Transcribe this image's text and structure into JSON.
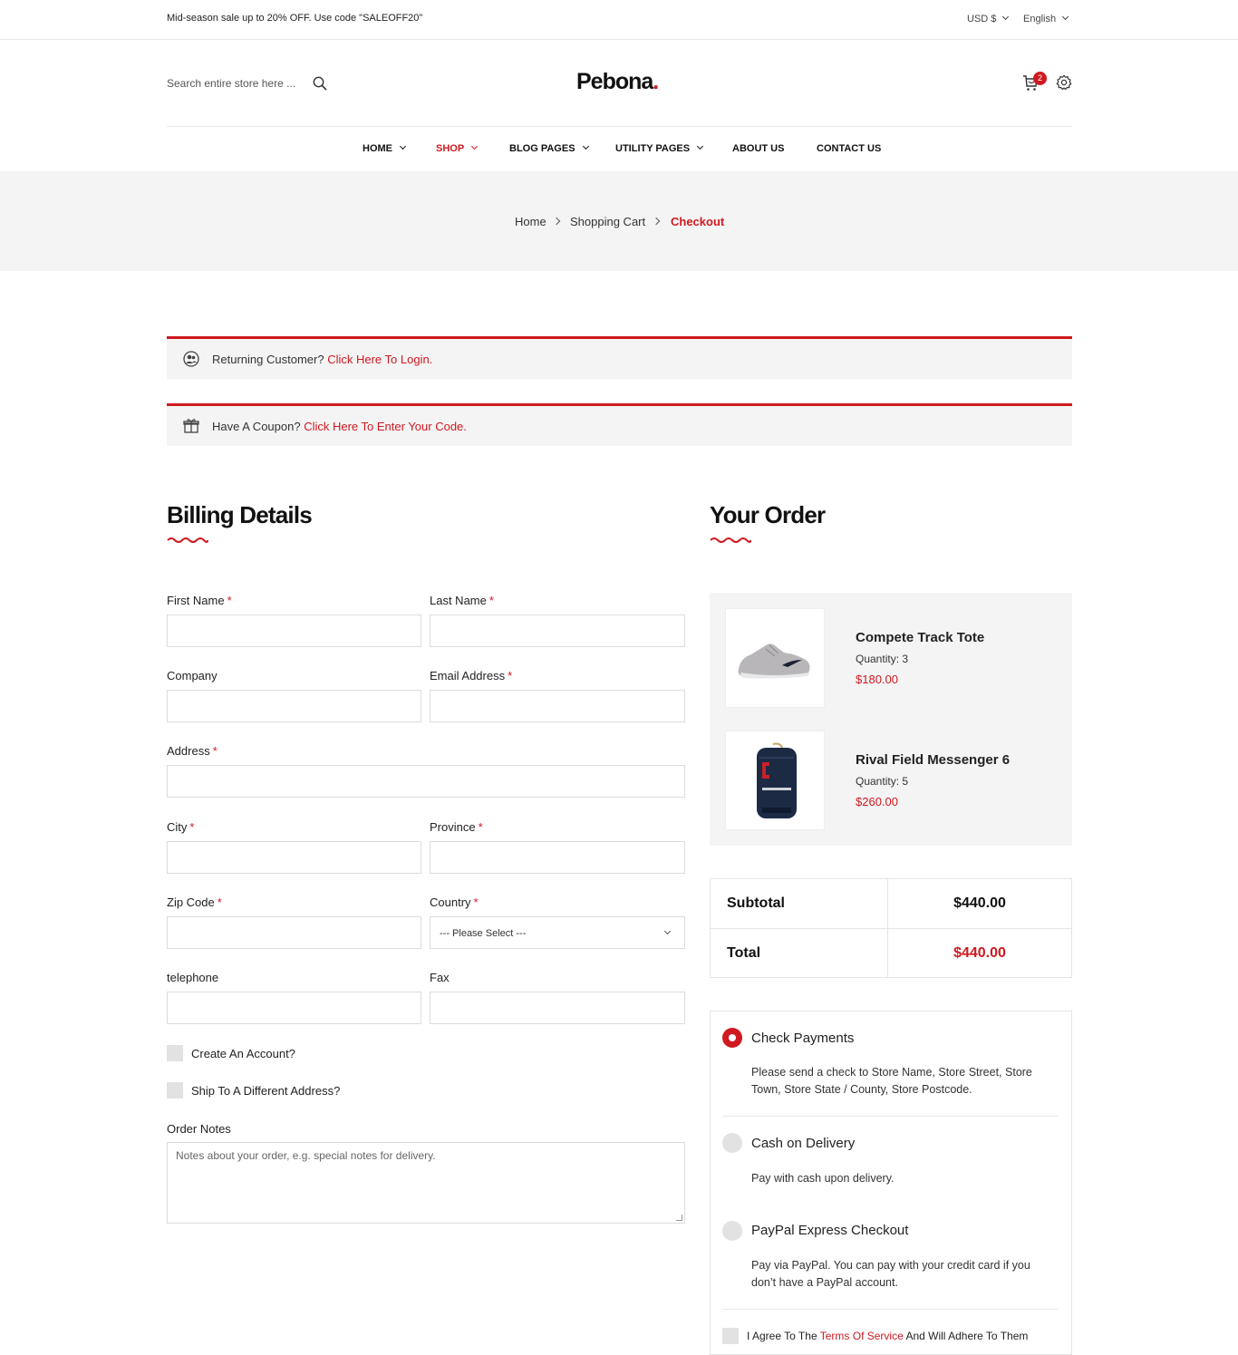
{
  "topbar": {
    "promo": "Mid-season sale up to 20% OFF. Use code \"SALEOFF20\"",
    "currency": "USD $",
    "language": "English"
  },
  "header": {
    "search_placeholder": "Search entire store here ...",
    "logo": "Pebona",
    "logo_dot": ".",
    "cart_count": "2"
  },
  "nav": {
    "home": "HOME",
    "shop": "SHOP",
    "blog": "BLOG PAGES",
    "utility": "UTILITY PAGES",
    "about": "ABOUT US",
    "contact": "CONTACT US"
  },
  "breadcrumb": {
    "home": "Home",
    "cart": "Shopping Cart",
    "current": "Checkout"
  },
  "notices": {
    "login_text": "Returning Customer?",
    "login_link": "Click Here To Login.",
    "coupon_text": "Have A Coupon?",
    "coupon_link": "Click Here To Enter Your Code."
  },
  "billing": {
    "title": "Billing Details",
    "first_name": "First Name",
    "last_name": "Last Name",
    "company": "Company",
    "email": "Email Address",
    "address": "Address",
    "city": "City",
    "province": "Province",
    "zip": "Zip Code",
    "country": "Country",
    "country_value": "--- Please Select ---",
    "telephone": "telephone",
    "fax": "Fax",
    "create_account": "Create An Account?",
    "ship_different": "Ship To A Different Address?",
    "order_notes": "Order Notes",
    "notes_placeholder": "Notes about your order, e.g. special notes for delivery.",
    "required_mark": "*"
  },
  "order": {
    "title": "Your Order",
    "items": [
      {
        "name": "Compete Track Tote",
        "qty": "Quantity: 3",
        "price": "$180.00"
      },
      {
        "name": "Rival Field Messenger 6",
        "qty": "Quantity: 5",
        "price": "$260.00"
      }
    ],
    "subtotal_label": "Subtotal",
    "subtotal_value": "$440.00",
    "total_label": "Total",
    "total_value": "$440.00"
  },
  "payment": {
    "methods": [
      {
        "title": "Check Payments",
        "desc": "Please send a check to Store Name, Store Street, Store Town, Store State / County, Store Postcode."
      },
      {
        "title": "Cash on Delivery",
        "desc": "Pay with cash upon delivery."
      },
      {
        "title": "PayPal Express Checkout",
        "desc": "Pay via PayPal. You can pay with your credit card if you don’t have a PayPal account."
      }
    ],
    "agree_prefix": "I Agree To The",
    "agree_link": "Terms Of Service",
    "agree_suffix": "And Will Adhere To Them"
  },
  "colors": {
    "accent": "#d0191f",
    "panel": "#f4f4f4"
  }
}
